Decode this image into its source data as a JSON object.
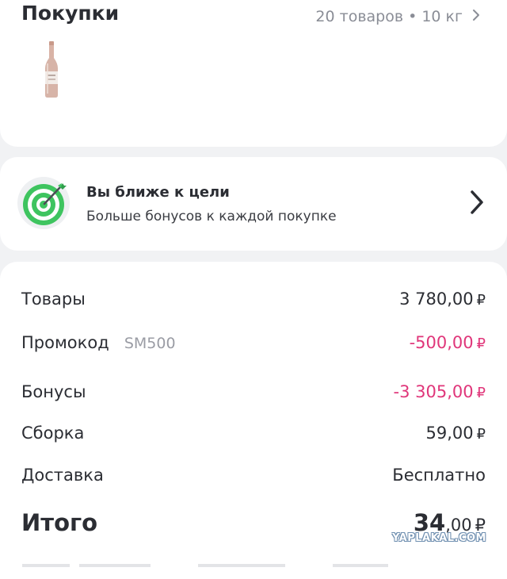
{
  "purchases": {
    "title": "Покупки",
    "summary": "20 товаров • 10 кг",
    "chevron_icon": "chevron-right-icon",
    "product_thumbnail_icon": "beer-bottle-icon"
  },
  "goal": {
    "title": "Вы ближе к цели",
    "subtitle": "Больше бонусов к каждой покупке",
    "icon": "target-dart-icon",
    "chevron_icon": "chevron-right-icon"
  },
  "totals": {
    "goods_label": "Товары",
    "goods_value": "3 780,00",
    "promo_label": "Промокод",
    "promo_code": "SM500",
    "promo_value": "-500,00",
    "bonus_label": "Бонусы",
    "bonus_value": "-3 305,00",
    "assembly_label": "Сборка",
    "assembly_value": "59,00",
    "delivery_label": "Доставка",
    "delivery_value": "Бесплатно",
    "total_label": "Итого",
    "total_rubles": "34",
    "total_kopecks": ",00",
    "currency": "₽"
  },
  "watermark": "YAPLAKAL.COM",
  "colors": {
    "accent_negative": "#e0367a",
    "muted_text": "#8a8d96",
    "goal_green": "#3ec45f"
  }
}
